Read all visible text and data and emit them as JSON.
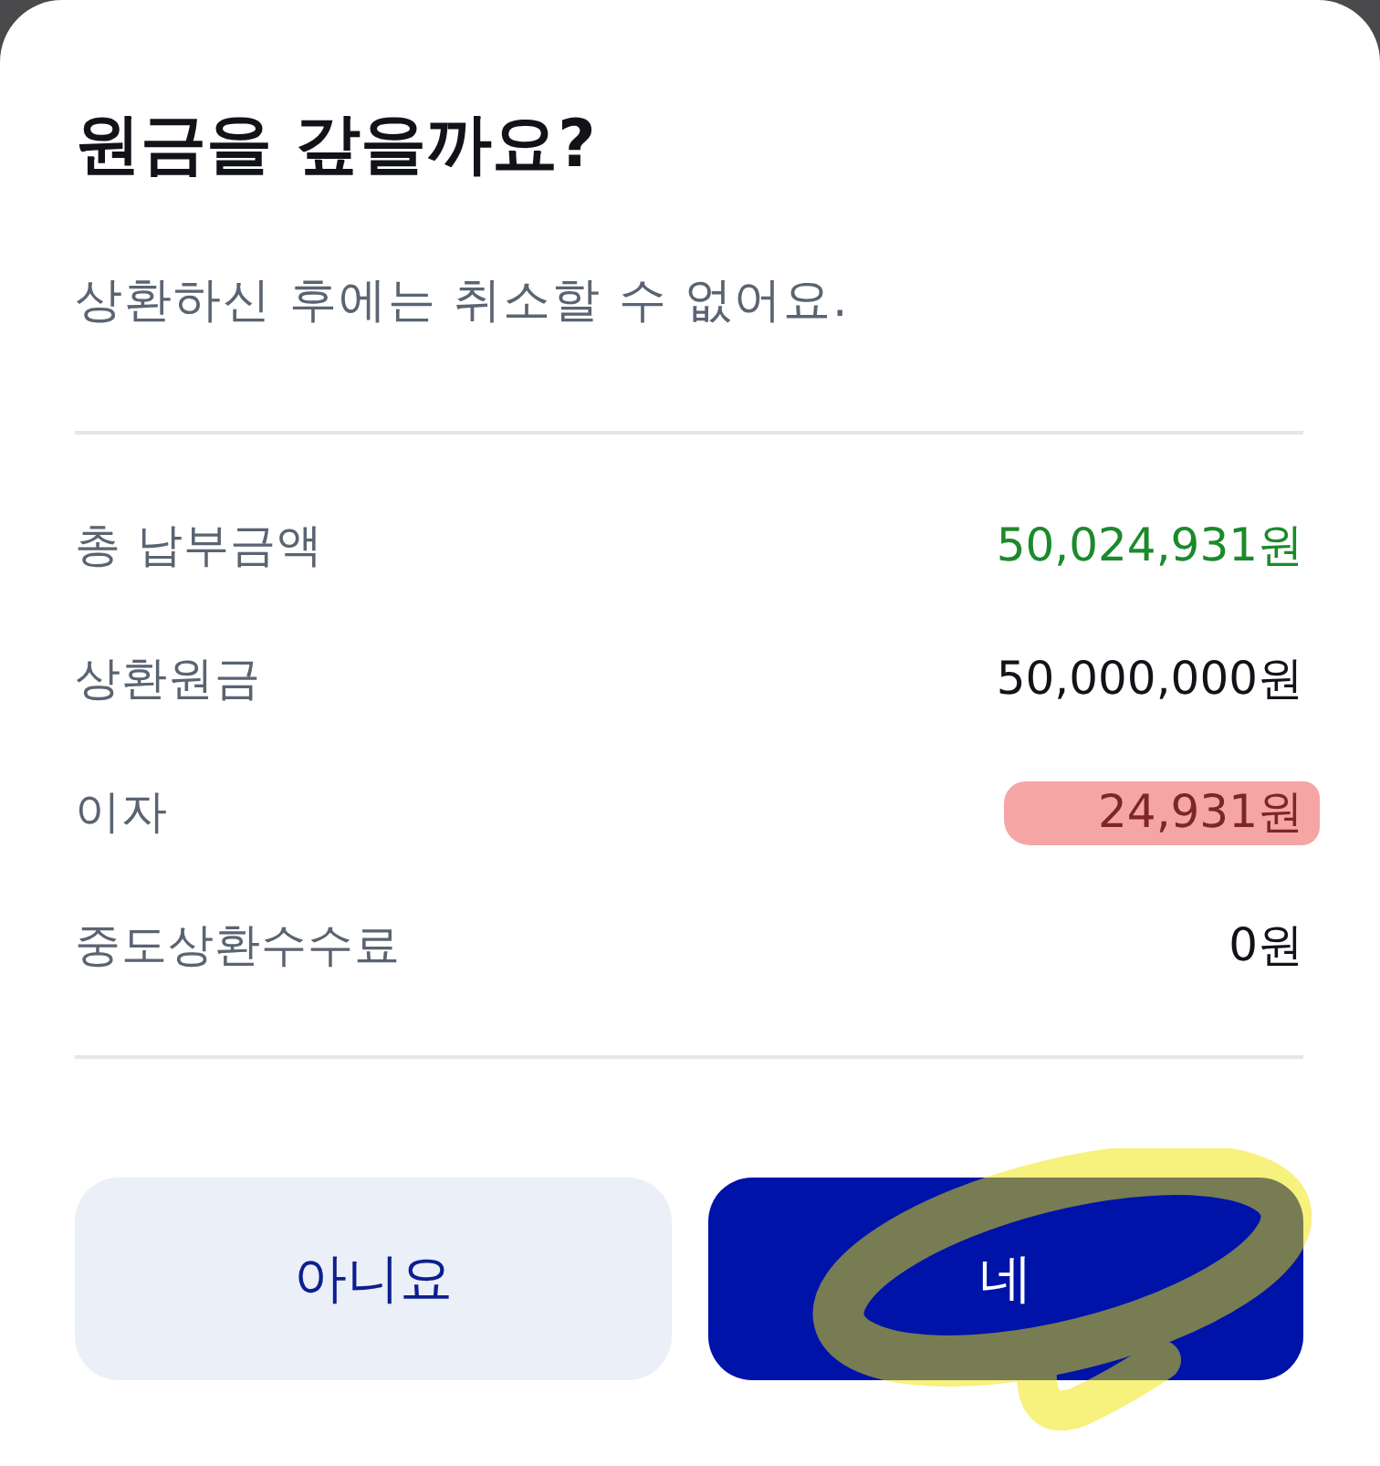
{
  "sheet": {
    "title": "원금을 갚을까요?",
    "subtitle": "상환하신 후에는 취소할 수 없어요."
  },
  "rows": [
    {
      "label": "총 납부금액",
      "value": "50,024,931원",
      "kind": "positive",
      "highlighted": false
    },
    {
      "label": "상환원금",
      "value": "50,000,000원",
      "kind": "plain",
      "highlighted": false
    },
    {
      "label": "이자",
      "value": "24,931원",
      "kind": "plain",
      "highlighted": true
    },
    {
      "label": "중도상환수수료",
      "value": "0원",
      "kind": "plain",
      "highlighted": false
    }
  ],
  "buttons": [
    {
      "kind": "secondary",
      "label": "아니요",
      "circled": false
    },
    {
      "kind": "primary",
      "label": "네",
      "circled": true
    }
  ]
}
